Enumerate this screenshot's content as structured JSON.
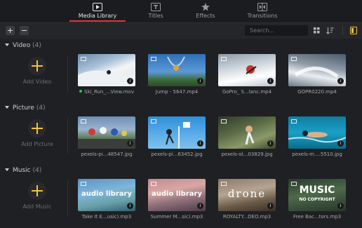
{
  "tabs": [
    {
      "label": "Media Library",
      "icon": "media-library-icon",
      "active": true
    },
    {
      "label": "Titles",
      "icon": "titles-icon",
      "active": false
    },
    {
      "label": "Effects",
      "icon": "effects-icon",
      "active": false
    },
    {
      "label": "Transitions",
      "icon": "transitions-icon",
      "active": false
    }
  ],
  "toolbar": {
    "search_placeholder": "Search...",
    "add_icon": "plus-icon",
    "remove_icon": "minus-icon",
    "grid_icon": "grid-view-icon",
    "sort_icon": "sort-icon",
    "panel_icon": "panel-toggle-icon"
  },
  "colors": {
    "accent": "#e0393e",
    "plus": "#f2c335",
    "online_dot": "#33c24d"
  },
  "sections": {
    "video": {
      "title": "Video",
      "count": "(4)",
      "add_label": "Add Video",
      "items": [
        {
          "name": "Ski_Run_...View.mov",
          "online": true
        },
        {
          "name": "Jump - 5647.mp4"
        },
        {
          "name": "GoPro_ S...lanc.mp4"
        },
        {
          "name": "GOPR0220.mp4"
        }
      ]
    },
    "picture": {
      "title": "Picture",
      "count": "(4)",
      "add_label": "Add Picture",
      "items": [
        {
          "name": "pexels-pi...48547.jpg"
        },
        {
          "name": "pexels-pi...63452.jpg"
        },
        {
          "name": "pexels-ol...03829.jpg"
        },
        {
          "name": "pexels-m....5510.jpg"
        }
      ]
    },
    "music": {
      "title": "Music",
      "count": "(4)",
      "add_label": "Add Music",
      "items": [
        {
          "name": "Take It E...usic).mp3",
          "overlay": "audio library"
        },
        {
          "name": "Summer M...sic).mp3",
          "overlay": "audio library"
        },
        {
          "name": "ROYALTY...DEO.mp3",
          "overlay": "drone"
        },
        {
          "name": "Free Bac...tors.mp3",
          "overlay": "MUSIC",
          "overlay_sub": "NO COPYRIGHT"
        }
      ]
    }
  },
  "info_glyph": "i"
}
